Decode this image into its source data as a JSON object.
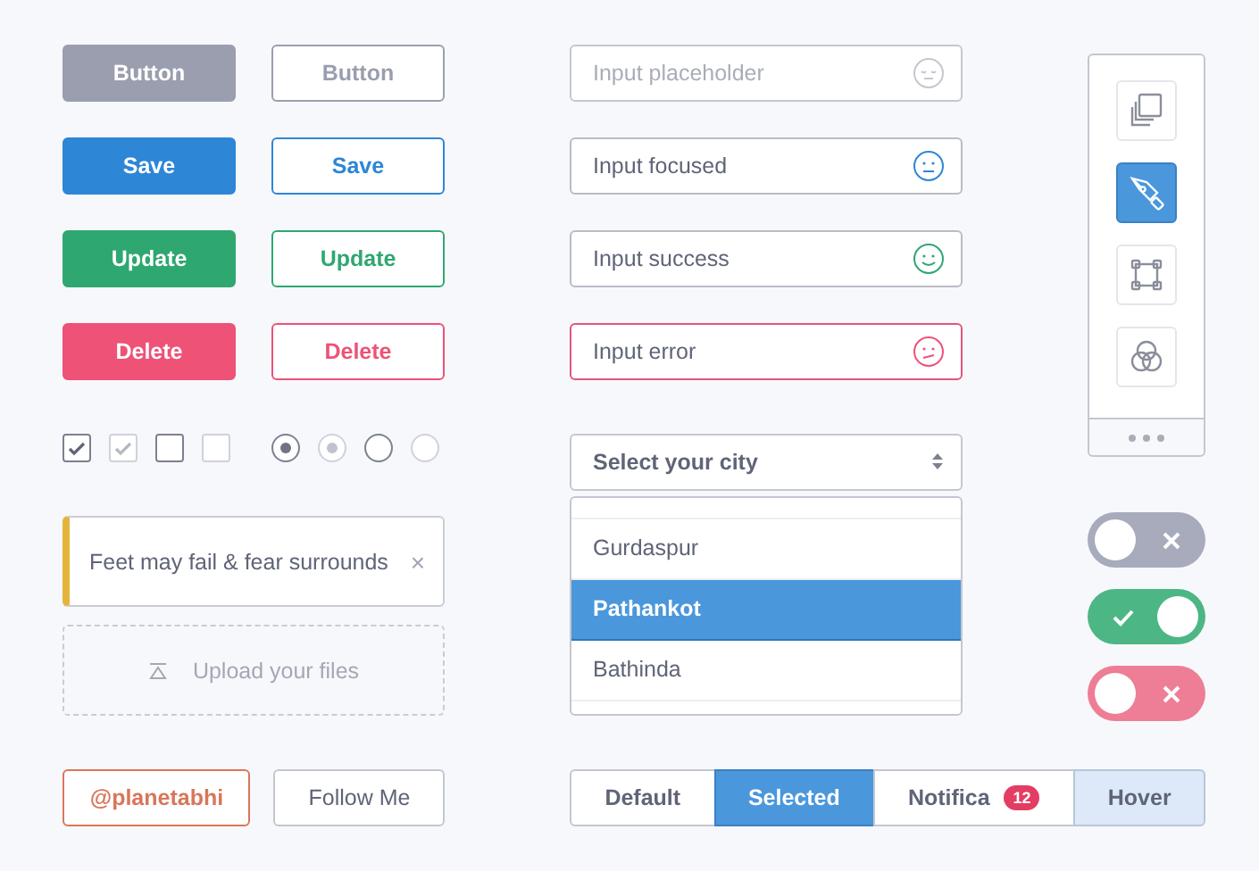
{
  "buttons": [
    {
      "label": "Button",
      "kind": "filled",
      "color": "#9a9eae"
    },
    {
      "label": "Button",
      "kind": "outline",
      "color": "#9a9eae"
    },
    {
      "label": "Save",
      "kind": "filled",
      "color": "#2d86d6"
    },
    {
      "label": "Save",
      "kind": "outline",
      "color": "#2d86d6"
    },
    {
      "label": "Update",
      "kind": "filled",
      "color": "#2fa771"
    },
    {
      "label": "Update",
      "kind": "outline",
      "color": "#2fa771"
    },
    {
      "label": "Delete",
      "kind": "filled",
      "color": "#ee5277"
    },
    {
      "label": "Delete",
      "kind": "outline",
      "color": "#ee5277"
    }
  ],
  "checkboxes": [
    {
      "checked": true,
      "disabled": false
    },
    {
      "checked": true,
      "disabled": true
    },
    {
      "checked": false,
      "disabled": false
    },
    {
      "checked": false,
      "disabled": true
    }
  ],
  "radios": [
    {
      "checked": true,
      "disabled": false
    },
    {
      "checked": true,
      "disabled": true
    },
    {
      "checked": false,
      "disabled": false
    },
    {
      "checked": false,
      "disabled": true
    }
  ],
  "alert": {
    "text": "Feet may fail & fear surrounds",
    "close": "×"
  },
  "upload": {
    "label": "Upload your files"
  },
  "follow": {
    "handle": "@planetabhi",
    "label": "Follow Me"
  },
  "inputs": [
    {
      "kind": "empty",
      "placeholder": "Input placeholder"
    },
    {
      "kind": "focused",
      "value": "Input focused"
    },
    {
      "kind": "success",
      "value": "Input success"
    },
    {
      "kind": "error",
      "value": "Input error"
    }
  ],
  "select": {
    "label": "Select your city",
    "options": [
      {
        "label": "Gurdaspur",
        "selected": false
      },
      {
        "label": "Pathankot",
        "selected": true
      },
      {
        "label": "Bathinda",
        "selected": false
      }
    ]
  },
  "segments": [
    {
      "label": "Default",
      "selected": false,
      "hovered": false
    },
    {
      "label": "Selected",
      "selected": true,
      "hovered": false
    },
    {
      "label": "Notifica",
      "badge": "12",
      "selected": false,
      "hovered": false
    },
    {
      "label": "Hover",
      "selected": false,
      "hovered": true
    }
  ],
  "tools": [
    {
      "kind": "copy",
      "selected": false
    },
    {
      "kind": "pen",
      "selected": true
    },
    {
      "kind": "transform",
      "selected": false
    },
    {
      "kind": "blend",
      "selected": false
    }
  ],
  "toggles": [
    {
      "on": false,
      "color": "#a7abbb"
    },
    {
      "on": true,
      "color": "#4db685"
    },
    {
      "on": false,
      "color": "#ee7d96"
    }
  ]
}
